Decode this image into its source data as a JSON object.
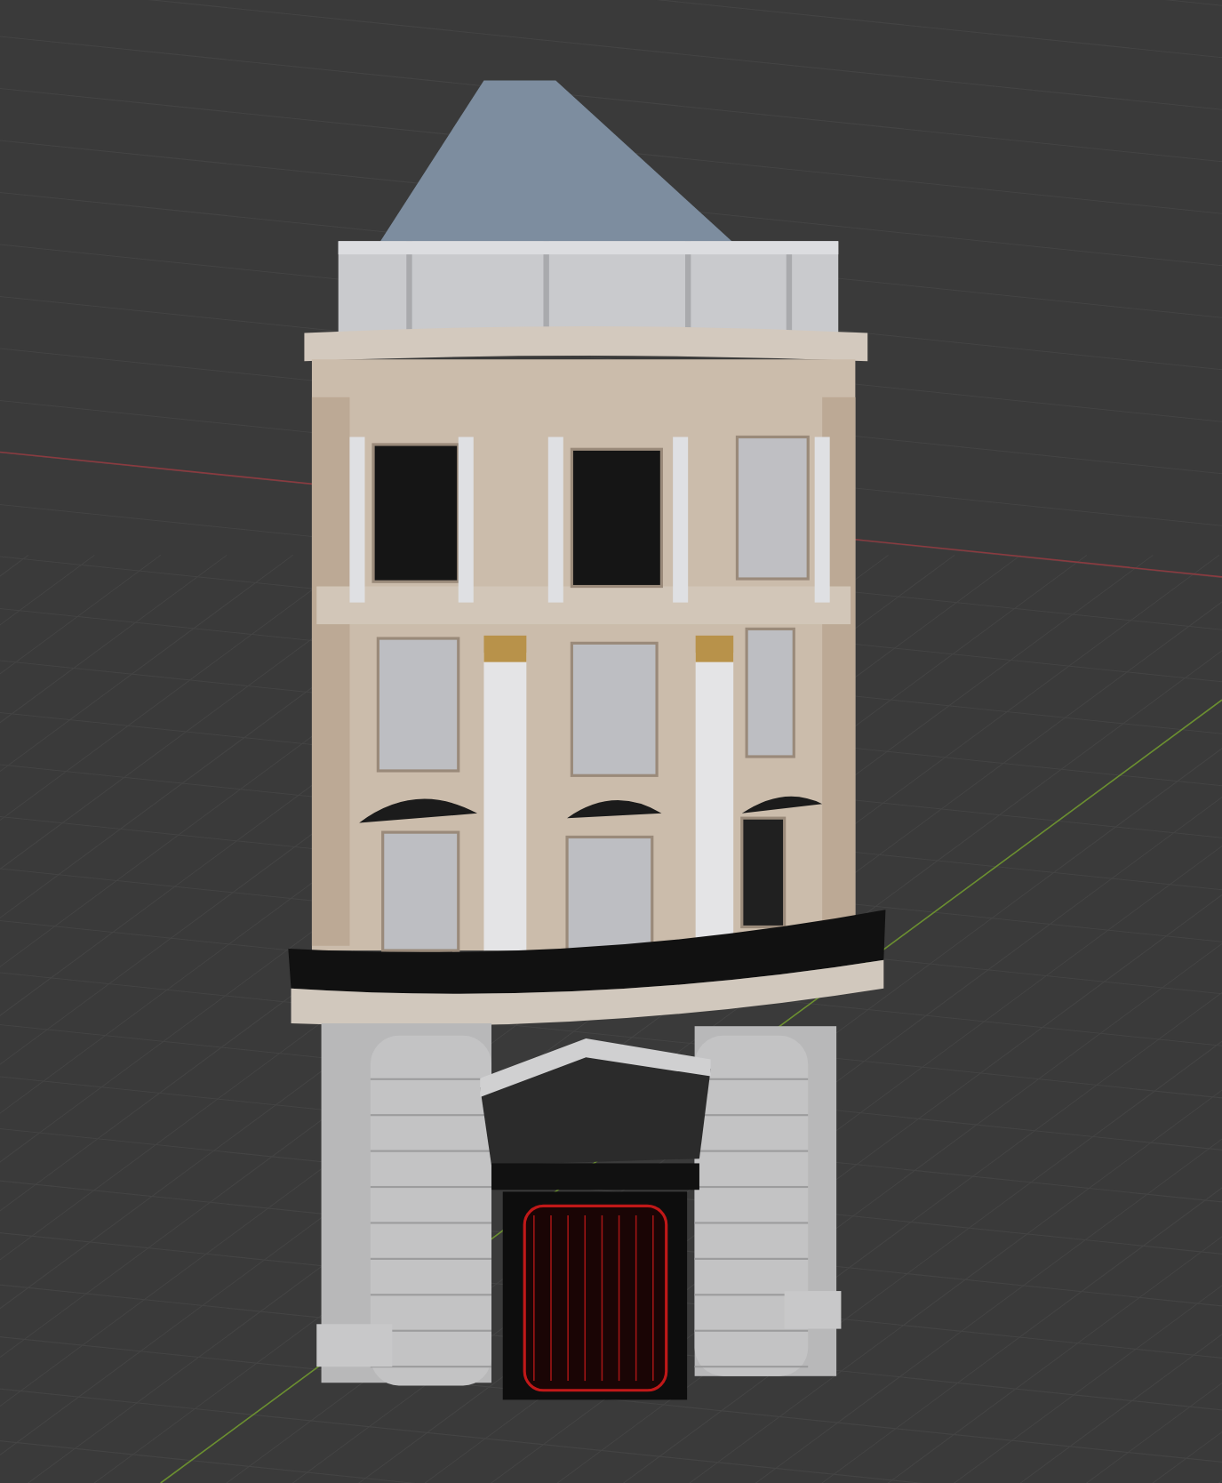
{
  "viewport": {
    "axes": [
      {
        "kind": "x",
        "color": "#8a3b40"
      },
      {
        "kind": "y",
        "color": "#6b8f30"
      }
    ]
  }
}
